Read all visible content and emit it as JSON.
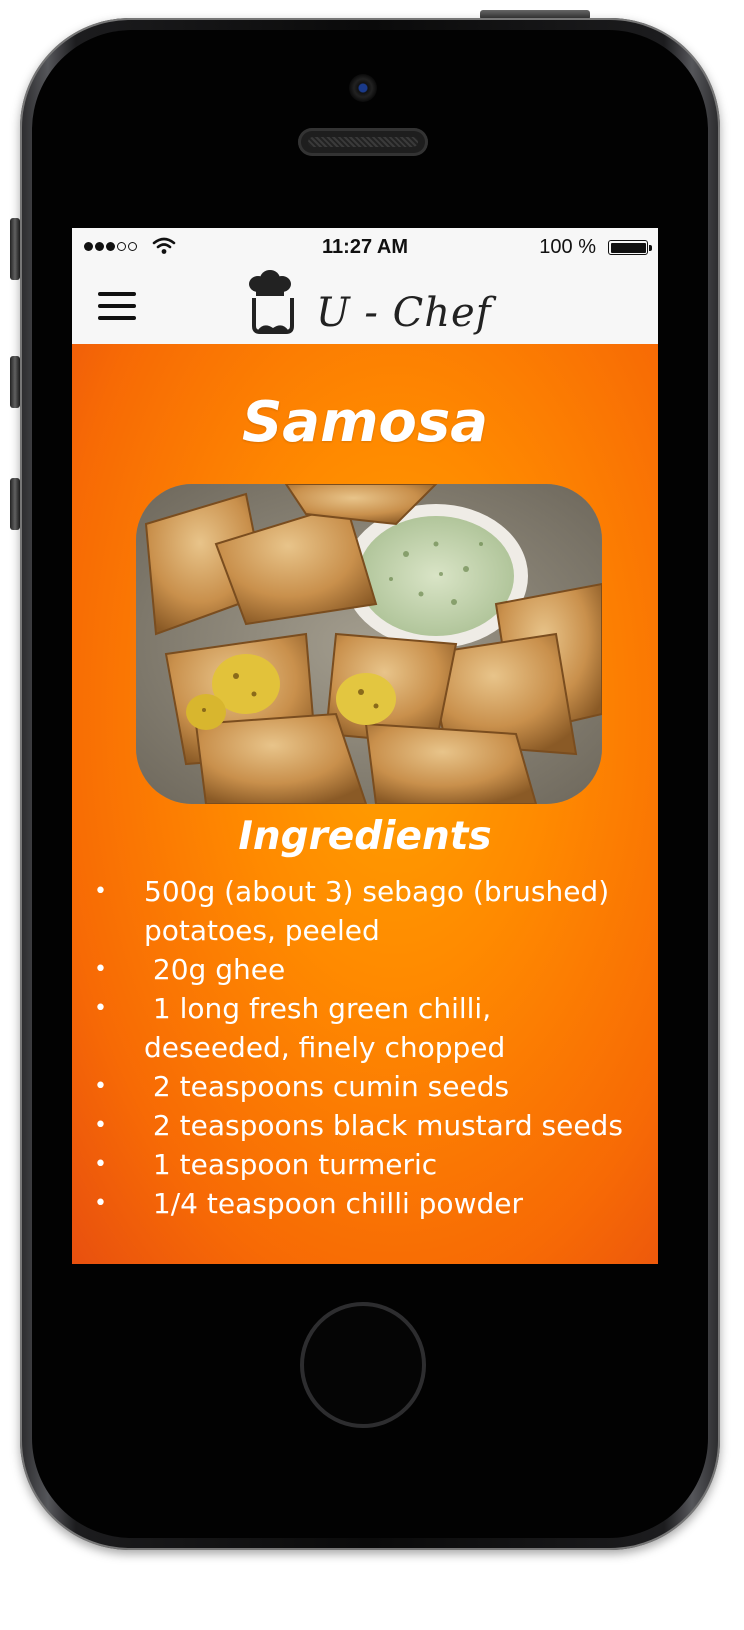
{
  "status_bar": {
    "time": "11:27 AM",
    "battery_percent": "100 %",
    "signal_icon": "signal-dots-icon",
    "wifi_icon": "wifi-icon",
    "battery_icon": "battery-full-icon"
  },
  "nav": {
    "menu_icon": "hamburger-menu-icon",
    "logo_text": "U - Chef",
    "logo_icon": "chef-hat-mustache-icon"
  },
  "recipe": {
    "title": "Samosa",
    "image_icon": "samosa-photo",
    "ingredients_heading": "Ingredients",
    "ingredients": [
      "500g (about 3) sebago (brushed) potatoes, peeled",
      " 20g ghee",
      " 1 long fresh green chilli, deseeded, finely chopped",
      " 2 teaspoons cumin seeds",
      " 2 teaspoons black mustard seeds",
      " 1 teaspoon turmeric",
      " 1/4 teaspoon chilli powder"
    ]
  },
  "colors": {
    "accent_orange": "#ff8a00",
    "bar_background": "#f7f7f7",
    "text_light": "#ffffff"
  }
}
